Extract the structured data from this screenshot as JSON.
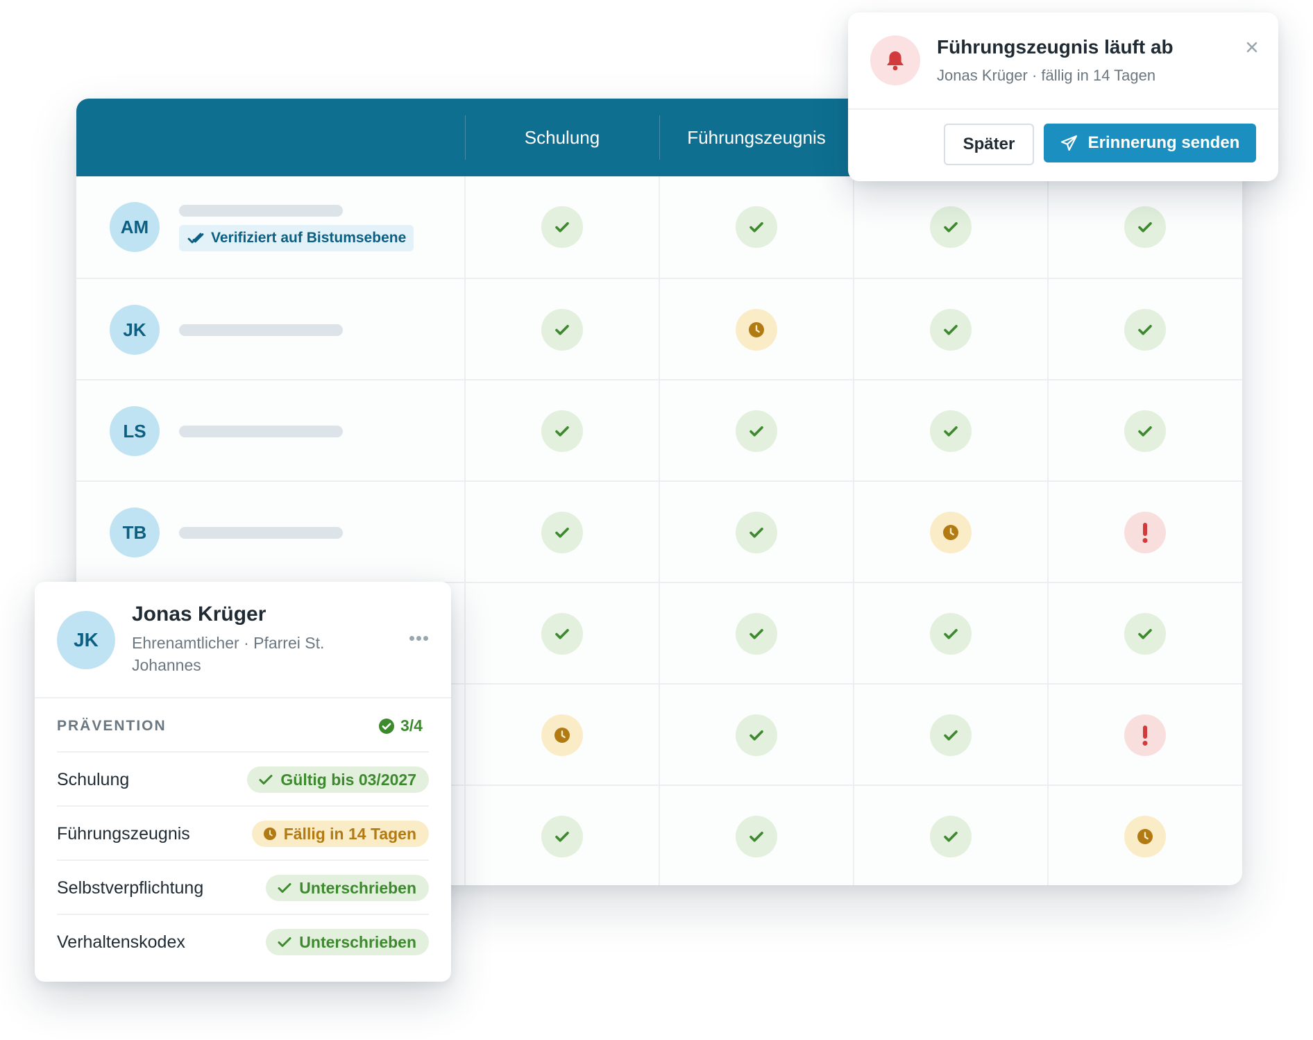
{
  "colors": {
    "header": "#0e6f91",
    "ok": "#3d8a2e",
    "pending": "#b27a12",
    "alert": "#d23b3b",
    "primary_button": "#1b8fbf"
  },
  "matrix": {
    "columns": [
      "Schulung",
      "Führungszeugnis",
      "",
      ""
    ],
    "rows": [
      {
        "initials": "AM",
        "badge": "Verifiziert auf Bistumsebene",
        "statuses": [
          "ok",
          "ok",
          "ok",
          "ok"
        ]
      },
      {
        "initials": "JK",
        "badge": "",
        "statuses": [
          "ok",
          "pending",
          "ok",
          "ok"
        ]
      },
      {
        "initials": "LS",
        "badge": "",
        "statuses": [
          "ok",
          "ok",
          "ok",
          "ok"
        ]
      },
      {
        "initials": "TB",
        "badge": "",
        "statuses": [
          "ok",
          "ok",
          "pending",
          "alert"
        ]
      },
      {
        "initials": "",
        "badge": "",
        "statuses": [
          "ok",
          "ok",
          "ok",
          "ok"
        ]
      },
      {
        "initials": "",
        "badge": "",
        "statuses": [
          "pending",
          "ok",
          "ok",
          "alert"
        ]
      },
      {
        "initials": "",
        "badge": "",
        "statuses": [
          "ok",
          "ok",
          "ok",
          "pending"
        ]
      }
    ]
  },
  "notification": {
    "icon": "bell-icon",
    "title": "Führungszeugnis läuft ab",
    "subtitle": "Jonas Krüger · fällig in 14 Tagen",
    "later_label": "Später",
    "send_label": "Erinnerung senden"
  },
  "person": {
    "initials": "JK",
    "name": "Jonas Krüger",
    "role": "Ehrenamtlicher · Pfarrei St. Johannes",
    "section_label": "PRÄVENTION",
    "progress": "3/4",
    "items": [
      {
        "label": "Schulung",
        "status": "ok",
        "value": "Gültig bis 03/2027"
      },
      {
        "label": "Führungszeugnis",
        "status": "pending",
        "value": "Fällig in 14 Tagen"
      },
      {
        "label": "Selbstverpflichtung",
        "status": "ok",
        "value": "Unterschrieben"
      },
      {
        "label": "Verhaltenskodex",
        "status": "ok",
        "value": "Unterschrieben"
      }
    ]
  }
}
